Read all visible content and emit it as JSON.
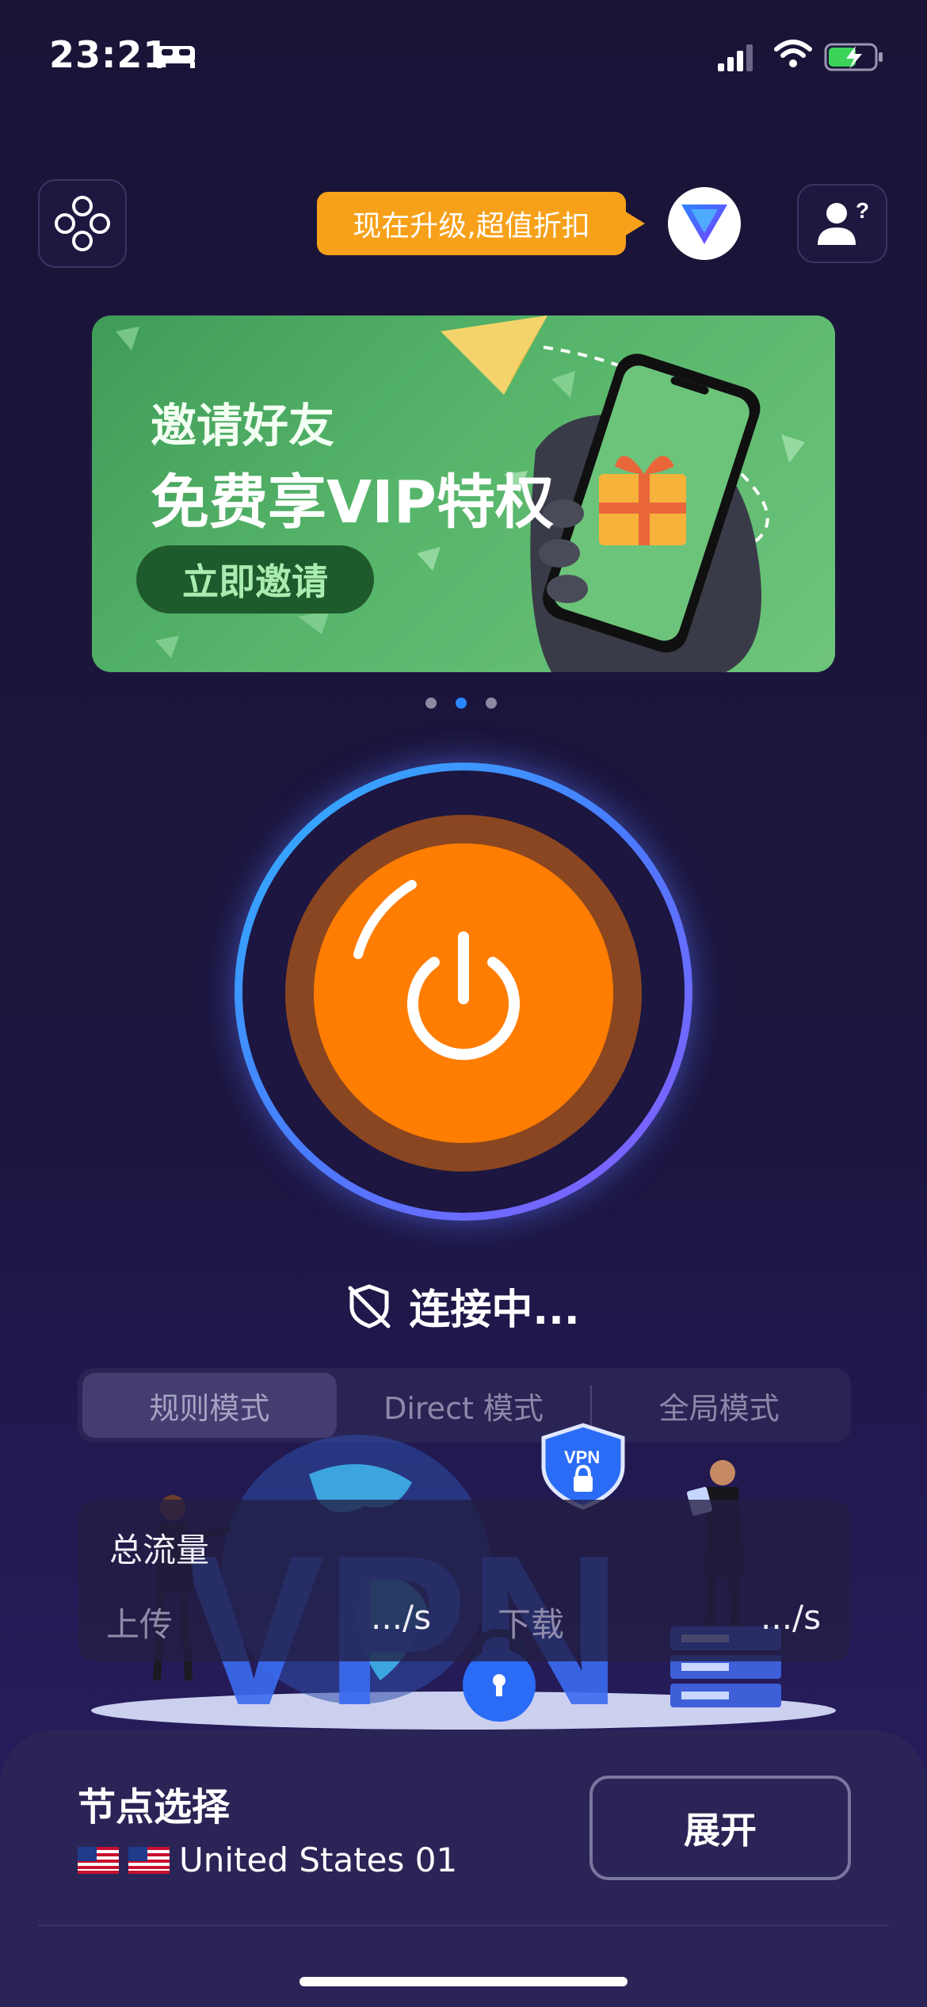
{
  "status_bar": {
    "time": "23:21"
  },
  "header": {
    "promo_text": "现在升级,超值折扣"
  },
  "banner": {
    "line1": "邀请好友",
    "line2": "免费享VIP特权",
    "button": "立即邀请",
    "page_count": 3,
    "active_page": 2
  },
  "connection": {
    "status": "连接中..."
  },
  "modes": {
    "items": [
      "规则模式",
      "Direct 模式",
      "全局模式"
    ],
    "selected": "规则模式"
  },
  "illustration": {
    "watermark": "VPN",
    "badge": "VPN"
  },
  "traffic": {
    "title": "总流量",
    "upload_label": "上传",
    "upload_value": ".../s",
    "download_label": "下载",
    "download_value": ".../s"
  },
  "node": {
    "title": "节点选择",
    "name": "United States 01",
    "expand_label": "展开"
  },
  "colors": {
    "power_button": "#ff7d00",
    "promo": "#f7a11a",
    "accent_blue": "#2a86ff"
  }
}
